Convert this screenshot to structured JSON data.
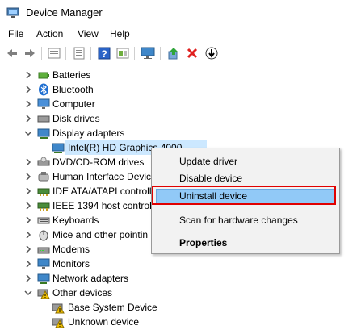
{
  "window": {
    "title": "Device Manager"
  },
  "menubar": [
    "File",
    "Action",
    "View",
    "Help"
  ],
  "toolbar": {
    "icons": [
      "back-arrow-icon",
      "forward-arrow-icon",
      "properties-icon",
      "view-icon",
      "help-icon",
      "scan-icon",
      "monitor-icon",
      "update-driver-icon",
      "uninstall-x-icon",
      "download-arrow-icon"
    ]
  },
  "tree": {
    "items": [
      "Batteries",
      "Bluetooth",
      "Computer",
      "Disk drives",
      "Display adapters",
      "Intel(R) HD Graphics 4000",
      "DVD/CD-ROM drives",
      "Human Interface Devic",
      "IDE ATA/ATAPI controll",
      "IEEE 1394 host controlle",
      "Keyboards",
      "Mice and other pointin",
      "Modems",
      "Monitors",
      "Network adapters",
      "Other devices",
      "Base System Device",
      "Unknown device"
    ]
  },
  "context_menu": {
    "items": [
      "Update driver",
      "Disable device",
      "Uninstall device",
      "Scan for hardware changes",
      "Properties"
    ],
    "highlighted": "Uninstall device"
  },
  "colors": {
    "selection": "#cce8ff",
    "highlight": "#91c9f7",
    "redbox": "#e00000"
  }
}
